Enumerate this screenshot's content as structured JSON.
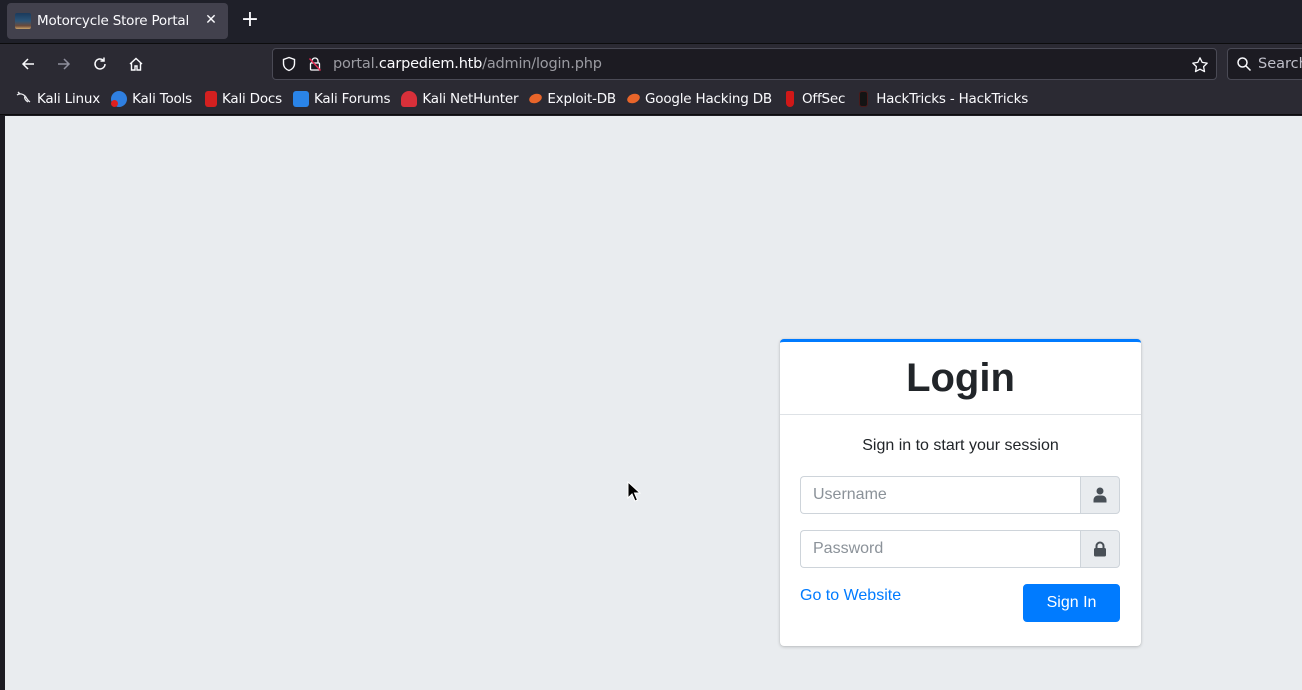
{
  "browser": {
    "tab": {
      "title": "Motorcycle Store Portal"
    },
    "url": {
      "prefix": "portal.",
      "host": "carpediem.htb",
      "path": "/admin/login.php"
    },
    "search_placeholder": "Search",
    "bookmarks": [
      {
        "label": "Kali Linux",
        "icon": "kali-dragon-icon",
        "color": "#1c1b22"
      },
      {
        "label": "Kali Tools",
        "icon": "kali-tools-icon",
        "color": "#2f7fe0"
      },
      {
        "label": "Kali Docs",
        "icon": "kali-docs-icon",
        "color": "#d42020"
      },
      {
        "label": "Kali Forums",
        "icon": "kali-forums-icon",
        "color": "#2a84e8"
      },
      {
        "label": "Kali NetHunter",
        "icon": "kali-nethunter-icon",
        "color": "#d8303a"
      },
      {
        "label": "Exploit-DB",
        "icon": "exploit-db-icon",
        "color": "#e8652a"
      },
      {
        "label": "Google Hacking DB",
        "icon": "ghdb-icon",
        "color": "#e8652a"
      },
      {
        "label": "OffSec",
        "icon": "offsec-icon",
        "color": "#d01818"
      },
      {
        "label": "HackTricks - HackTricks",
        "icon": "hacktricks-icon",
        "color": "#141414"
      }
    ]
  },
  "page": {
    "colors": {
      "accent": "#007bff",
      "background": "#e9ecef",
      "text": "#212529"
    },
    "login": {
      "title": "Login",
      "message": "Sign in to start your session",
      "username": {
        "placeholder": "Username",
        "value": ""
      },
      "password": {
        "placeholder": "Password",
        "value": ""
      },
      "website_link": "Go to Website",
      "submit_label": "Sign In"
    }
  }
}
